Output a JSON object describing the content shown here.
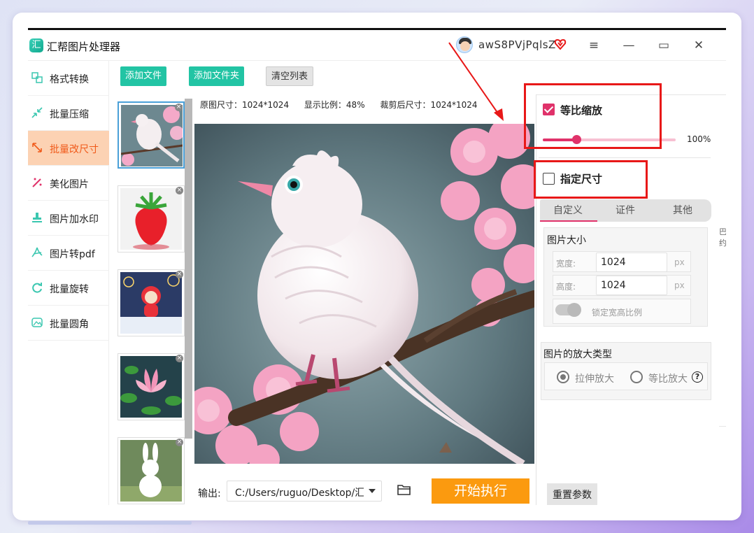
{
  "app": {
    "title": "汇帮图片处理器",
    "logo_glyph": "汇",
    "username": "awS8PVjPqlsZ",
    "icons": {
      "vip": "vip-heart-icon",
      "menu": "hamburger-menu-icon",
      "minimize": "minimize-icon",
      "maximize": "maximize-icon",
      "close": "close-icon"
    }
  },
  "titlebar": {
    "menu_glyph": "≡",
    "minimize_glyph": "—",
    "maximize_glyph": "▭",
    "close_glyph": "✕"
  },
  "sidebar": {
    "items": [
      {
        "label": "格式转换",
        "icon": "format-convert-icon"
      },
      {
        "label": "批量压缩",
        "icon": "compress-icon"
      },
      {
        "label": "批量改尺寸",
        "icon": "resize-icon",
        "active": true
      },
      {
        "label": "美化图片",
        "icon": "beautify-icon"
      },
      {
        "label": "图片加水印",
        "icon": "watermark-icon"
      },
      {
        "label": "图片转pdf",
        "icon": "to-pdf-icon"
      },
      {
        "label": "批量旋转",
        "icon": "rotate-icon"
      },
      {
        "label": "批量圆角",
        "icon": "round-corner-icon"
      }
    ]
  },
  "toolbar": {
    "add_file": "添加文件",
    "add_folder": "添加文件夹",
    "clear_list": "清空列表"
  },
  "thumbnails": [
    {
      "subject": "white bird on pink blossom",
      "selected": true
    },
    {
      "subject": "strawberry"
    },
    {
      "subject": "cartoon character with fireworks"
    },
    {
      "subject": "pink lotus"
    },
    {
      "subject": "white rabbit"
    }
  ],
  "thumb_close_glyph": "×",
  "info": {
    "original_size": "原图尺寸：1024*1024",
    "display_ratio": "显示比例：48%",
    "cropped_size": "裁剪后尺寸：1024*1024"
  },
  "output": {
    "label": "输出:",
    "path": "C:/Users/ruguo/Desktop/汇帮",
    "start_button": "开始执行"
  },
  "right_panel": {
    "proportional": {
      "label": "等比缩放",
      "checked": true,
      "scale_percent": 100,
      "value_text": "100%"
    },
    "specify_size": {
      "label": "指定尺寸",
      "checked": false
    },
    "tabs": [
      "自定义",
      "证件",
      "其他"
    ],
    "active_tab": 0,
    "image_size": {
      "title": "图片大小",
      "width_label": "宽度:",
      "width_value": "1024",
      "height_label": "高度:",
      "height_value": "1024",
      "unit": "px",
      "lock_ratio_label": "锁定宽高比例"
    },
    "enlarge": {
      "title": "图片的放大类型",
      "options": [
        "拉伸放大",
        "等比放大"
      ],
      "selected": 0,
      "help_glyph": "?"
    },
    "reset_button": "重置参数",
    "edge_text": "巴约"
  },
  "colors": {
    "accent_pink": "#e0326a",
    "green_button": "#22c4a4",
    "orange_button": "#fb9a0f",
    "active_sidebar_bg": "#fcd2b3",
    "active_sidebar_text": "#f05a1a",
    "annotation_red": "#e81818"
  }
}
